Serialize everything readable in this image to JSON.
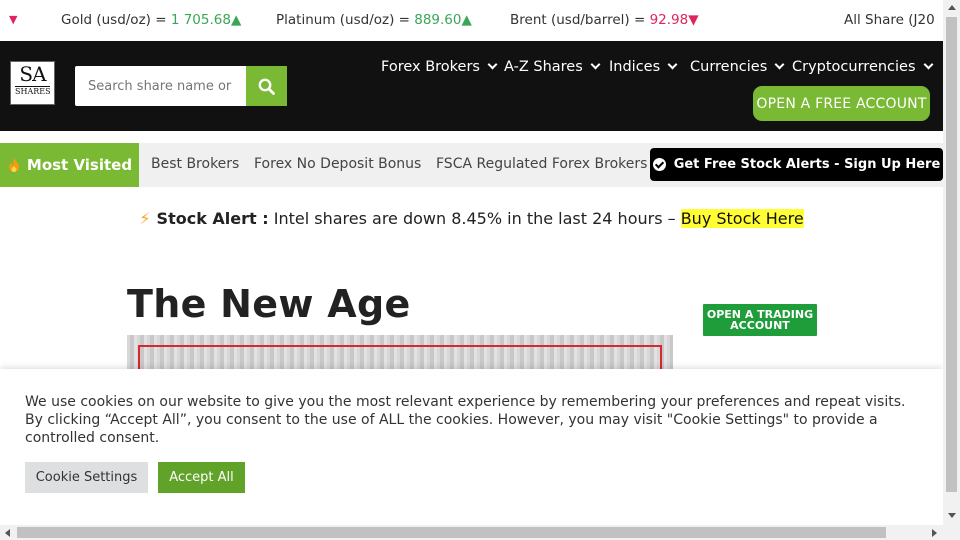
{
  "ticker": {
    "items": [
      {
        "label": "Gold (usd/oz) = ",
        "value": "1 705.68",
        "arrow": "▲",
        "trend": "up"
      },
      {
        "label": "Platinum (usd/oz) = ",
        "value": "889.60",
        "arrow": "▲",
        "trend": "up"
      },
      {
        "label": "Brent (usd/barrel) = ",
        "value": "92.98",
        "arrow": "▼",
        "trend": "down"
      },
      {
        "label": "All Share (J20",
        "value": "",
        "arrow": "",
        "trend": ""
      }
    ],
    "lead_arrow": "▼"
  },
  "header": {
    "logo_top": "SA",
    "logo_bottom": "SHARES",
    "search_placeholder": "Search share name or ID",
    "nav": [
      {
        "label": "Forex Brokers"
      },
      {
        "label": "A-Z Shares"
      },
      {
        "label": "Indices"
      },
      {
        "label": "Currencies"
      },
      {
        "label": "Cryptocurrencies"
      }
    ],
    "free_account_label": "OPEN A FREE ACCOUNT"
  },
  "most_visited": {
    "label": "Most Visited",
    "links": [
      {
        "label": "Best Brokers"
      },
      {
        "label": "Forex No Deposit Bonus"
      },
      {
        "label": "FSCA Regulated Forex Brokers"
      }
    ],
    "alerts_label": "Get Free Stock Alerts - Sign Up Here"
  },
  "stock_alert": {
    "prefix": "Stock Alert :",
    "message": " Intel shares are down 8.45% in the last 24 hours – ",
    "cta": "Buy Stock Here"
  },
  "article": {
    "title": "The New Age",
    "trade_button_line1": "OPEN A TRADING",
    "trade_button_line2": "ACCOUNT"
  },
  "cookie": {
    "text": "We use cookies on our website to give you the most relevant experience by remembering your preferences and repeat visits. By clicking “Accept All”, you consent to the use of ALL the cookies. However, you may visit \"Cookie Settings\" to provide a controlled consent.",
    "settings_label": "Cookie Settings",
    "accept_label": "Accept All"
  },
  "colors": {
    "brand_green": "#7ab934",
    "header_bg": "#111111",
    "ticker_up": "#3aa655",
    "ticker_down": "#e0245e",
    "highlight": "#ffff33"
  }
}
